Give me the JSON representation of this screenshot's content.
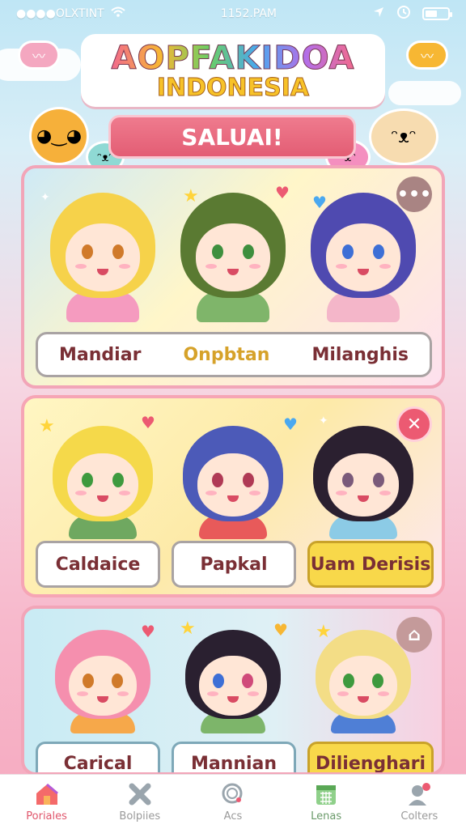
{
  "status_bar": {
    "carrier": "●●●●OLXTINT",
    "time": "1152.PAM"
  },
  "header": {
    "title": "AOPFAKIDOA",
    "subtitle": "INDONESIA",
    "banner": "SALUAI!"
  },
  "colors": {
    "accent": "#e35d74",
    "gold": "#d6a22a",
    "name_text": "#7a2f35"
  },
  "panels": [
    {
      "action_icon": "more-icon",
      "characters": [
        {
          "name": "Mandiar",
          "hair": "#f6d24a",
          "eyes": "#d07a2a",
          "shirt": "#f59bbf"
        },
        {
          "name": "Onpbtan",
          "hair": "#5a7a32",
          "eyes": "#3e8f3e",
          "shirt": "#7fb56a",
          "highlight": true
        },
        {
          "name": "Milanghis",
          "hair": "#4f4ab0",
          "eyes": "#3d6fd6",
          "shirt": "#f4b6c9"
        }
      ]
    },
    {
      "action_icon": "close-icon",
      "characters": [
        {
          "name": "Caldaice",
          "hair": "#f5d94a",
          "eyes": "#3e9a3e",
          "shirt": "#6fa860"
        },
        {
          "name": "Papkal",
          "hair": "#4c5ab8",
          "eyes": "#b03a55",
          "shirt": "#e85a5a"
        },
        {
          "name": "Uam Derisis",
          "hair": "#2b2030",
          "eyes": "#7a5a7a",
          "shirt": "#8ccbe6",
          "highlight": true
        }
      ]
    },
    {
      "action_icon": "home-icon",
      "characters": [
        {
          "name": "Carical",
          "hair": "#f58fae",
          "eyes": "#d07a2a",
          "shirt": "#f6a84a"
        },
        {
          "name": "Mannian",
          "hair": "#2a2030",
          "eyes": "#d04a7a",
          "shirt": "#7db56a"
        },
        {
          "name": "Dilienghari",
          "hair": "#f3dd86",
          "eyes": "#3e9a3e",
          "shirt": "#4f7fd6",
          "highlight": true
        }
      ]
    }
  ],
  "bottom_nav": [
    {
      "label": "Poriales",
      "icon": "home-icon",
      "active": true
    },
    {
      "label": "Bolpiies",
      "icon": "cross-icon"
    },
    {
      "label": "Acs",
      "icon": "search-icon"
    },
    {
      "label": "Lenas",
      "icon": "calendar-icon"
    },
    {
      "label": "Colters",
      "icon": "user-icon"
    }
  ]
}
